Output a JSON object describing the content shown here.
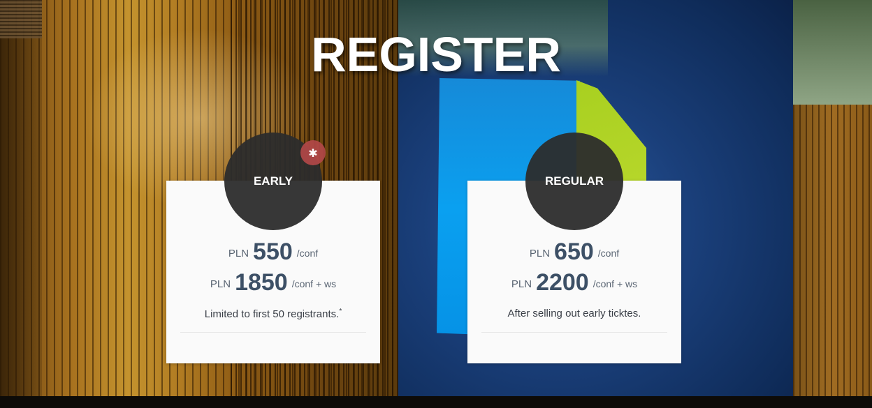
{
  "page": {
    "title": "REGISTER"
  },
  "tickets": {
    "early": {
      "label": "EARLY",
      "asterisk": "✱",
      "conf": {
        "currency": "PLN",
        "amount": "550",
        "unit": "/conf"
      },
      "combo": {
        "currency": "PLN",
        "amount": "1850",
        "unit": "/conf + ws"
      },
      "note": "Limited to first 50 registrants.",
      "note_mark": "*"
    },
    "regular": {
      "label": "REGULAR",
      "conf": {
        "currency": "PLN",
        "amount": "650",
        "unit": "/conf"
      },
      "combo": {
        "currency": "PLN",
        "amount": "2200",
        "unit": "/conf + ws"
      },
      "note": "After selling out early ticktes."
    }
  },
  "colors": {
    "card_bg": "#fafafa",
    "badge_bg": "#2c2c2c",
    "asterisk_bg": "#b24848",
    "price_text": "#3d5066"
  }
}
